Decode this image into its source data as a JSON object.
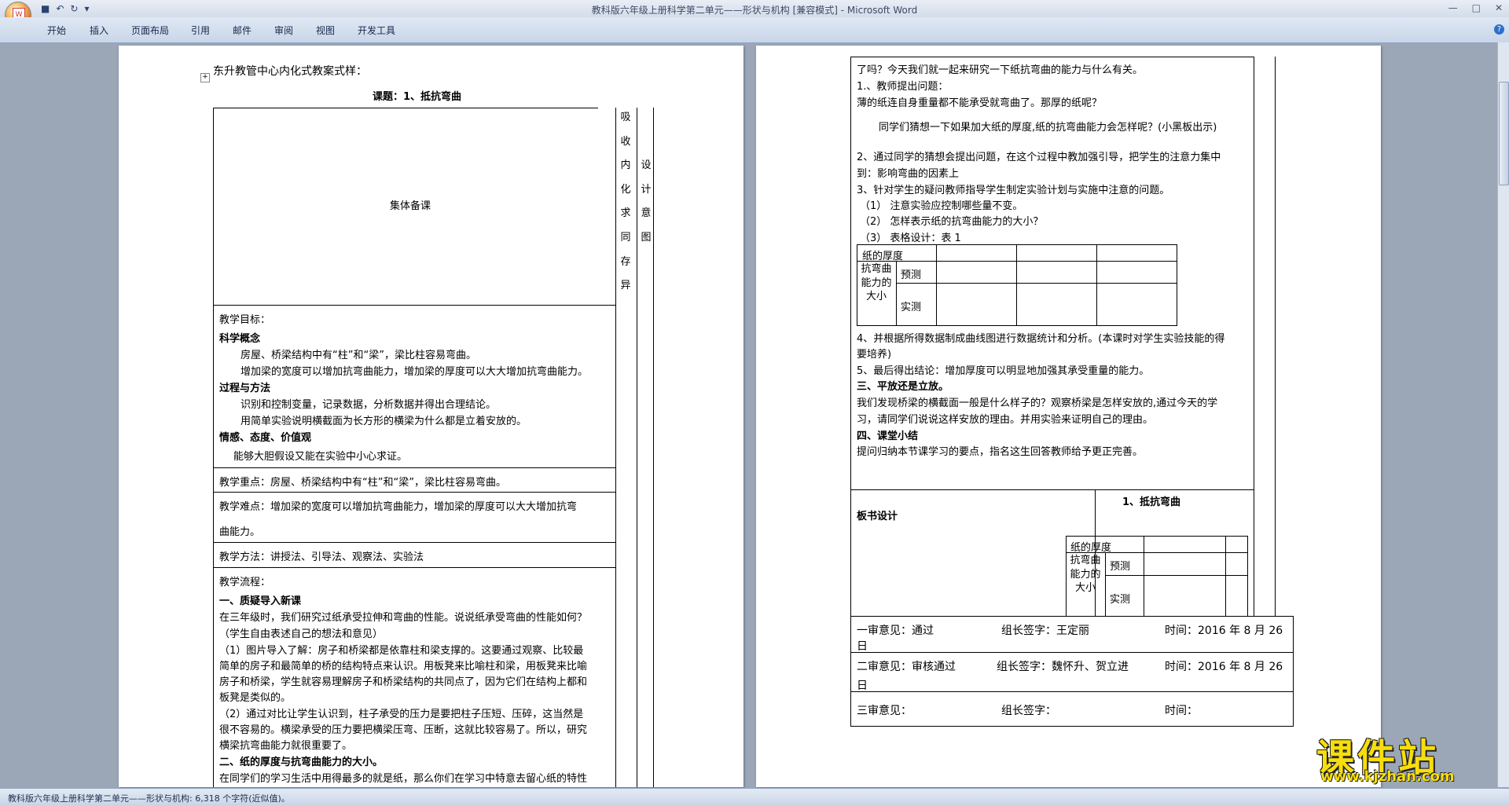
{
  "window": {
    "title": "教科版六年级上册科学第二单元——形状与机构 [兼容模式] - Microsoft Word",
    "qat_save": "■",
    "qat_undo": "↶",
    "qat_redo": "↻",
    "qat_more": "▾",
    "min": "—",
    "max": "□",
    "close": "✕"
  },
  "office_button": {
    "glyph": "W"
  },
  "ribbon": {
    "tabs": [
      "开始",
      "插入",
      "页面布局",
      "引用",
      "邮件",
      "审阅",
      "视图",
      "开发工具"
    ],
    "help": "?"
  },
  "doc": {
    "header": "东升教管中心内化式教案式样：",
    "lesson_title": "课题：1、抵抗弯曲",
    "col_group": "集体备课",
    "col_absorb": "吸收内化求同存异",
    "col_design": "设计意图",
    "goals_label": "教学目标：",
    "sci_label": "科学概念",
    "sci_1": "房屋、桥梁结构中有“柱”和“梁”，梁比柱容易弯曲。",
    "sci_2": "增加梁的宽度可以增加抗弯曲能力，增加梁的厚度可以大大增加抗弯曲能力。",
    "proc_label": "过程与方法",
    "proc_1": "识别和控制变量，记录数据，分析数据并得出合理结论。",
    "proc_2": "用简单实验说明横截面为长方形的横梁为什么都是立着安放的。",
    "att_label": "情感、态度、价值观",
    "att_1": "能够大胆假设又能在实验中小心求证。",
    "key_point": "教学重点：房屋、桥梁结构中有“柱”和“梁”，梁比柱容易弯曲。",
    "diff_a": "教学难点：增加梁的宽度可以增加抗弯曲能力，增加梁的厚度可以大大增加抗弯",
    "diff_b": "曲能力。",
    "method": "教学方法：讲授法、引导法、观察法、实验法",
    "flow_label": "教学流程：",
    "s1_title": "一、质疑导入新课",
    "s1_p1": "在三年级时，我们研究过纸承受拉伸和弯曲的性能。说说纸承受弯曲的性能如何？",
    "s1_p2": "（学生自由表述自己的想法和意见）",
    "s1_p3a": "（1）图片导入了解：房子和桥梁都是依靠柱和梁支撑的。这要通过观察、比较最",
    "s1_p3b": "简单的房子和最简单的桥的结构特点来认识。用板凳来比喻柱和梁，用板凳来比喻",
    "s1_p3c": "房子和桥梁，学生就容易理解房子和桥梁结构的共同点了，因为它们在结构上都和",
    "s1_p3d": "板凳是类似的。",
    "s1_p4a": "（2）通过对比让学生认识到，柱子承受的压力是要把柱子压短、压碎，这当然是",
    "s1_p4b": "很不容易的。横梁承受的压力要把横梁压弯、压断，这就比较容易了。所以，研究",
    "s1_p4c": "横梁抗弯曲能力就很重要了。",
    "s2_title": "二、纸的厚度与抗弯曲能力的大小。",
    "s2_p1": "在同学们的学习生活中用得最多的就是纸，那么你们在学习中特意去留心纸的特性",
    "p2_1": "了吗？今天我们就一起来研究一下纸抗弯曲的能力与什么有关。",
    "p2_2": "1.、教师提出问题：",
    "p2_3": "薄的纸连自身重量都不能承受就弯曲了。那厚的纸呢？",
    "p2_4": "同学们猜想一下如果加大纸的厚度,纸的抗弯曲能力会怎样呢？(小黑板出示)",
    "p2_5a": "2、通过同学的猜想会提出问题，在这个过程中教加强引导，把学生的注意力集中",
    "p2_5b": "到：影响弯曲的因素上",
    "p2_6": "3、针对学生的疑问教师指导学生制定实验计划与实施中注意的问题。",
    "p2_7": "（1）  注意实验应控制哪些量不变。",
    "p2_8": "（2）  怎样表示纸的抗弯曲能力的大小？",
    "p2_9": "（3）  表格设计：表 1",
    "tbl_thick": "纸的厚度",
    "tbl_resist": "抗弯曲能力的大小",
    "tbl_predict": "预测",
    "tbl_measure": "实测",
    "p2_10a": "4、并根据所得数据制成曲线图进行数据统计和分析。(本课时对学生实验技能的得",
    "p2_10b": "要培养)",
    "p2_11": "5、最后得出结论：增加厚度可以明显地加强其承受重量的能力。",
    "s3_title": "三、平放还是立放。",
    "s3_p1a": "我们发现桥梁的横截面一般是什么样子的？观察桥梁是怎样安放的,通过今天的学",
    "s3_p1b": "习，请同学们说说这样安放的理由。并用实验来证明自己的理由。",
    "s4_title": "四、课堂小结",
    "s4_p1": "提问归纳本节课学习的要点，指名这生回答教师给予更正完善。",
    "board_label": "板书设计",
    "board_title": "1、抵抗弯曲",
    "rev1_a": "一审意见：通过",
    "rev1_b": "组长签字：王定丽",
    "rev1_c": "时间：2016 年 8 月 26",
    "rev1_d": "日",
    "rev2_a": "二审意见：审核通过",
    "rev2_b": "组长签字：魏怀升、贺立进",
    "rev2_c": "时间：2016 年 8 月 26",
    "rev2_d": "日",
    "rev3_a": "三审意见：",
    "rev3_b": "组长签字：",
    "rev3_c": "时间："
  },
  "status": "教科版六年级上册科学第二单元——形状与机构: 6,318 个字符(近似值)。",
  "watermark": {
    "title": "课件站",
    "url": "www.kjzhan.com"
  }
}
